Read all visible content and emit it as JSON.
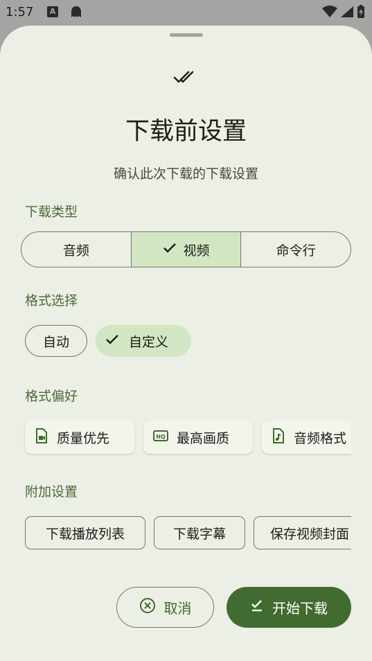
{
  "status_bar": {
    "time": "1:57",
    "notification_a": "A",
    "icons": [
      "ghost-icon",
      "wifi-icon",
      "signal-icon",
      "battery-charging-icon"
    ]
  },
  "dialog": {
    "icon": "double-check-icon",
    "title": "下载前设置",
    "subtitle": "确认此次下载的下载设置"
  },
  "download_type": {
    "label": "下载类型",
    "options": [
      "音频",
      "视频",
      "命令行"
    ],
    "selected": "视频"
  },
  "format_select": {
    "label": "格式选择",
    "options": [
      "自动",
      "自定义"
    ],
    "selected": "自定义"
  },
  "format_pref": {
    "label": "格式偏好",
    "items": [
      {
        "icon": "video-file-icon",
        "label": "质量优先"
      },
      {
        "icon": "hq-icon",
        "label": "最高画质"
      },
      {
        "icon": "audio-file-icon",
        "label": "音频格式"
      }
    ]
  },
  "extra": {
    "label": "附加设置",
    "items": [
      "下载播放列表",
      "下载字幕",
      "保存视频封面"
    ]
  },
  "actions": {
    "cancel": "取消",
    "start": "开始下载"
  },
  "colors": {
    "accent": "#426b30",
    "selected_bg": "#d2e6c3",
    "sheet_bg": "#ecefe5"
  }
}
